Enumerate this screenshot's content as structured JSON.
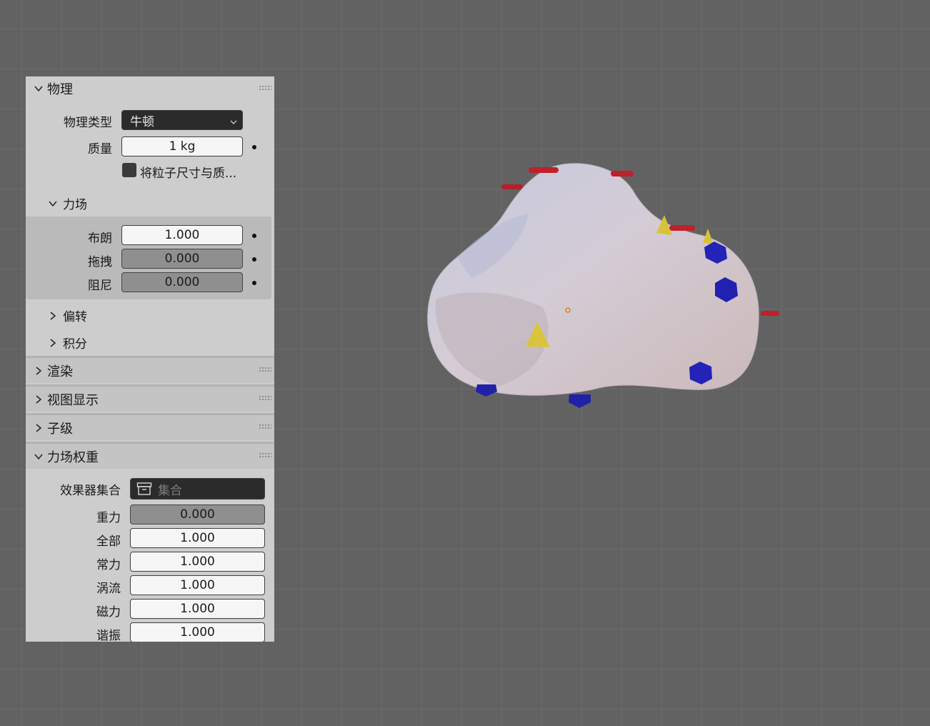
{
  "physics": {
    "title": "物理",
    "type_label": "物理类型",
    "type_value": "牛顿",
    "mass_label": "质量",
    "mass_value": "1 kg",
    "scale_checkbox_label": "将粒子尺寸与质...",
    "forces": {
      "title": "力场",
      "brownian_label": "布朗",
      "brownian_value": "1.000",
      "drag_label": "拖拽",
      "drag_value": "0.000",
      "damp_label": "阻尼",
      "damp_value": "0.000"
    },
    "deflection_label": "偏转",
    "integration_label": "积分"
  },
  "render": {
    "title": "渲染"
  },
  "viewport_display": {
    "title": "视图显示"
  },
  "children": {
    "title": "子级"
  },
  "field_weights": {
    "title": "力场权重",
    "collection_label": "效果器集合",
    "collection_placeholder": "集合",
    "gravity_label": "重力",
    "gravity_value": "0.000",
    "all_label": "全部",
    "all_value": "1.000",
    "force_label": "常力",
    "force_value": "1.000",
    "vortex_label": "涡流",
    "vortex_value": "1.000",
    "magnetic_label": "磁力",
    "magnetic_value": "1.000",
    "harmonic_label": "谐振",
    "harmonic_value": "1.000"
  },
  "colors": {
    "viewport_bg": "#626262",
    "panel_bg": "#cdcdcd",
    "mesh": "#d9d2da",
    "particle_red": "#c0202a",
    "particle_yellow": "#d8c23a",
    "particle_blue": "#2222bb"
  }
}
